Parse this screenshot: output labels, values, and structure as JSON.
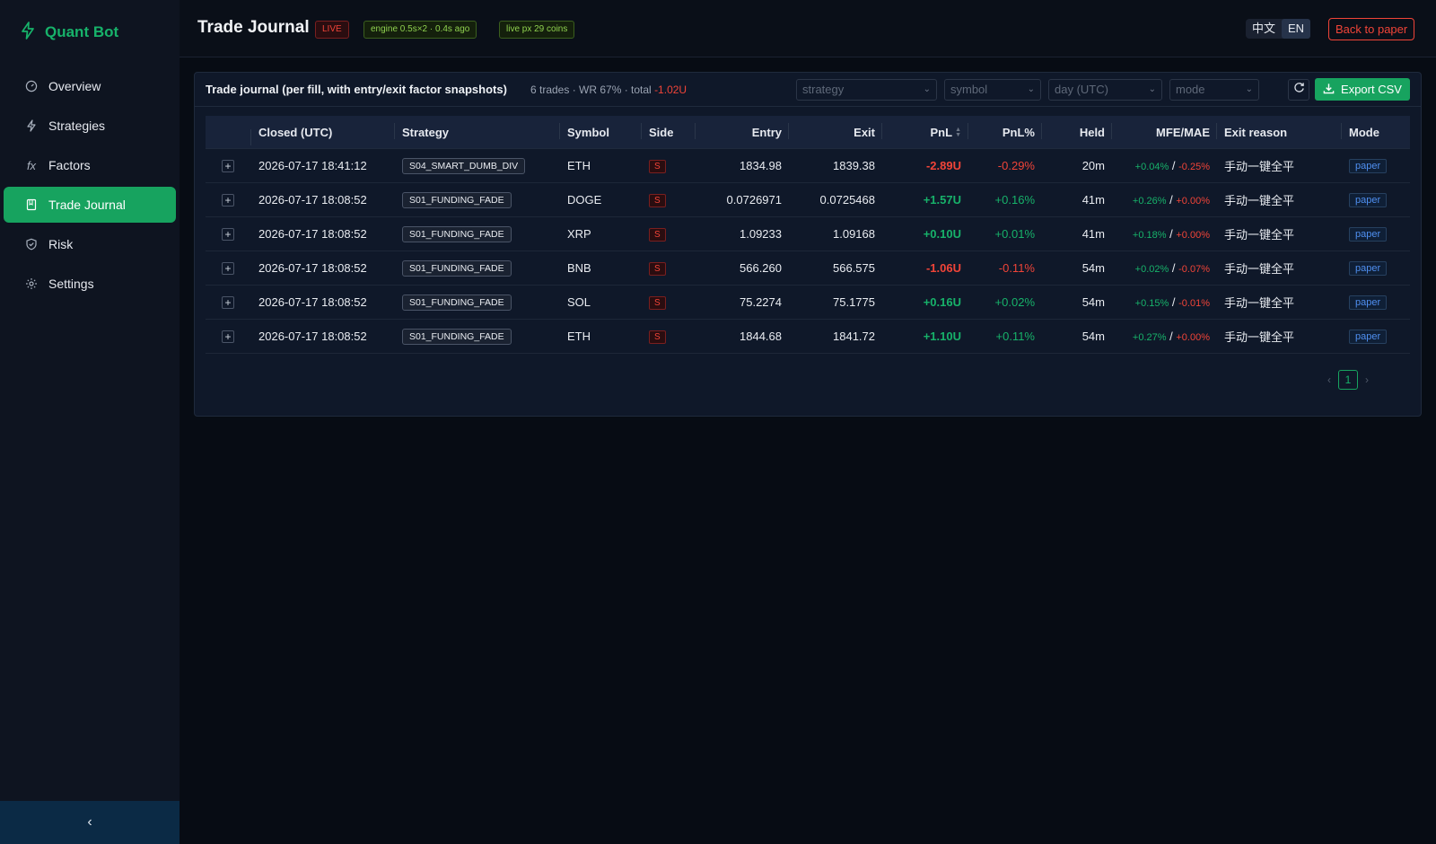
{
  "app": {
    "name": "Quant Bot"
  },
  "sidebar": {
    "items": [
      {
        "label": "Overview",
        "icon": "dashboard-icon"
      },
      {
        "label": "Strategies",
        "icon": "bolt-icon"
      },
      {
        "label": "Factors",
        "icon": "fx-icon",
        "glyph": "fx"
      },
      {
        "label": "Trade Journal",
        "icon": "journal-icon",
        "active": true
      },
      {
        "label": "Risk",
        "icon": "shield-icon"
      },
      {
        "label": "Settings",
        "icon": "gear-icon"
      }
    ],
    "collapse_glyph": "‹"
  },
  "header": {
    "title": "Trade Journal",
    "live_tag": "LIVE",
    "engine_tag": "engine 0.5s×2 · 0.4s ago",
    "px_tag": "live px 29 coins",
    "lang_zh": "中文",
    "lang_en": "EN",
    "back_label": "Back to paper"
  },
  "journal": {
    "title": "Trade journal (per fill, with entry/exit factor snapshots)",
    "summary_prefix": "6 trades · WR 67% · total",
    "summary_total": "-1.02U",
    "filters": {
      "strategy": "strategy",
      "symbol": "symbol",
      "day": "day (UTC)",
      "mode": "mode"
    },
    "export_label": "Export CSV",
    "columns": {
      "closed": "Closed (UTC)",
      "strategy": "Strategy",
      "symbol": "Symbol",
      "side": "Side",
      "entry": "Entry",
      "exit": "Exit",
      "pnl": "PnL",
      "pnl_pct": "PnL%",
      "held": "Held",
      "mfe_mae": "MFE/MAE",
      "exit_reason": "Exit reason",
      "mode": "Mode"
    },
    "rows": [
      {
        "closed": "2026-07-17 18:41:12",
        "strategy": "S04_SMART_DUMB_DIV",
        "symbol": "ETH",
        "side": "S",
        "entry": "1834.98",
        "exit": "1839.38",
        "pnl": "-2.89U",
        "pnl_sign": "neg",
        "pnl_pct": "-0.29%",
        "pct_sign": "neg",
        "held": "20m",
        "mfe": "+0.04%",
        "mae": "-0.25%",
        "mae_sign": "neg",
        "reason": "手动一键全平",
        "mode": "paper"
      },
      {
        "closed": "2026-07-17 18:08:52",
        "strategy": "S01_FUNDING_FADE",
        "symbol": "DOGE",
        "side": "S",
        "entry": "0.0726971",
        "exit": "0.0725468",
        "pnl": "+1.57U",
        "pnl_sign": "pos",
        "pnl_pct": "+0.16%",
        "pct_sign": "pos",
        "held": "41m",
        "mfe": "+0.26%",
        "mae": "+0.00%",
        "mae_sign": "neg",
        "reason": "手动一键全平",
        "mode": "paper"
      },
      {
        "closed": "2026-07-17 18:08:52",
        "strategy": "S01_FUNDING_FADE",
        "symbol": "XRP",
        "side": "S",
        "entry": "1.09233",
        "exit": "1.09168",
        "pnl": "+0.10U",
        "pnl_sign": "pos",
        "pnl_pct": "+0.01%",
        "pct_sign": "pos",
        "held": "41m",
        "mfe": "+0.18%",
        "mae": "+0.00%",
        "mae_sign": "neg",
        "reason": "手动一键全平",
        "mode": "paper"
      },
      {
        "closed": "2026-07-17 18:08:52",
        "strategy": "S01_FUNDING_FADE",
        "symbol": "BNB",
        "side": "S",
        "entry": "566.260",
        "exit": "566.575",
        "pnl": "-1.06U",
        "pnl_sign": "neg",
        "pnl_pct": "-0.11%",
        "pct_sign": "neg",
        "held": "54m",
        "mfe": "+0.02%",
        "mae": "-0.07%",
        "mae_sign": "neg",
        "reason": "手动一键全平",
        "mode": "paper"
      },
      {
        "closed": "2026-07-17 18:08:52",
        "strategy": "S01_FUNDING_FADE",
        "symbol": "SOL",
        "side": "S",
        "entry": "75.2274",
        "exit": "75.1775",
        "pnl": "+0.16U",
        "pnl_sign": "pos",
        "pnl_pct": "+0.02%",
        "pct_sign": "pos",
        "held": "54m",
        "mfe": "+0.15%",
        "mae": "-0.01%",
        "mae_sign": "neg",
        "reason": "手动一键全平",
        "mode": "paper"
      },
      {
        "closed": "2026-07-17 18:08:52",
        "strategy": "S01_FUNDING_FADE",
        "symbol": "ETH",
        "side": "S",
        "entry": "1844.68",
        "exit": "1841.72",
        "pnl": "+1.10U",
        "pnl_sign": "pos",
        "pnl_pct": "+0.11%",
        "pct_sign": "pos",
        "held": "54m",
        "mfe": "+0.27%",
        "mae": "+0.00%",
        "mae_sign": "neg",
        "reason": "手动一键全平",
        "mode": "paper"
      }
    ],
    "pagination": {
      "current": "1",
      "prev": "‹",
      "next": "›"
    }
  },
  "colors": {
    "accent": "#17a35f",
    "positive": "#17b26a",
    "negative": "#f04438",
    "mode": "#4f8ff0"
  }
}
